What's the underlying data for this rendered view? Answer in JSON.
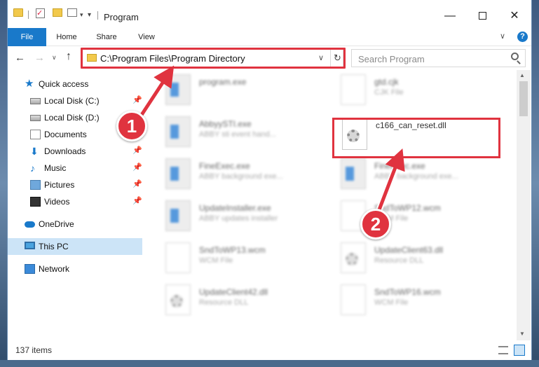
{
  "window": {
    "title": "Program"
  },
  "titlebar": {
    "qa_check_glyph": "✓",
    "caret": "▾",
    "down": "▾",
    "min": "—",
    "close": "✕"
  },
  "ribbon": {
    "tabs": [
      {
        "label": "File"
      },
      {
        "label": "Home"
      },
      {
        "label": "Share"
      },
      {
        "label": "View"
      }
    ],
    "chevron": "∨",
    "help": "?"
  },
  "nav": {
    "back": "←",
    "forward": "→",
    "recent": "∨",
    "up": "↑",
    "address": "C:\\Program Files\\Program Directory",
    "address_chevron": "∨",
    "refresh": "↻",
    "search_placeholder": "Search Program"
  },
  "sidebar": {
    "items": [
      {
        "label": "Quick access",
        "icon": "star-icon"
      },
      {
        "label": "Local Disk (C:)",
        "icon": "drive-icon"
      },
      {
        "label": "Local Disk (D:)",
        "icon": "drive-icon"
      },
      {
        "label": "Documents",
        "icon": "documents-icon"
      },
      {
        "label": "Downloads",
        "icon": "downloads-icon"
      },
      {
        "label": "Music",
        "icon": "music-icon"
      },
      {
        "label": "Pictures",
        "icon": "pictures-icon"
      },
      {
        "label": "Videos",
        "icon": "videos-icon"
      },
      {
        "label": "OneDrive",
        "icon": "cloud-icon"
      },
      {
        "label": "This PC",
        "icon": "computer-icon"
      },
      {
        "label": "Network",
        "icon": "network-icon"
      }
    ],
    "pin": "📌"
  },
  "files": [
    {
      "name": "program.exe",
      "desc": ""
    },
    {
      "name": "gtd.cjk",
      "desc": "CJK File"
    },
    {
      "name": "AbbyySTI.exe",
      "desc": "ABBY sti event hand..."
    },
    {
      "name": "c166_can_reset.dll",
      "desc": ""
    },
    {
      "name": "FineExec.exe",
      "desc": "ABBY background exe..."
    },
    {
      "name": "FineExec.exe",
      "desc": "ABBY background exe..."
    },
    {
      "name": "UpdateInstaller.exe",
      "desc": "ABBY updates installer"
    },
    {
      "name": "SndToWP12.wcm",
      "desc": "WCM File"
    },
    {
      "name": "SndToWP13.wcm",
      "desc": "WCM File"
    },
    {
      "name": "UpdateClient63.dll",
      "desc": "Resource DLL"
    },
    {
      "name": "UpdateClient42.dll",
      "desc": "Resource DLL"
    },
    {
      "name": "SndToWP16.wcm",
      "desc": "WCM File"
    }
  ],
  "scroll": {
    "up": "▲",
    "down": "▼"
  },
  "status": {
    "count": "137 items"
  },
  "annotations": {
    "badge1": "1",
    "badge2": "2"
  },
  "colors": {
    "accent": "#1979ca",
    "highlight": "#e0333f",
    "selected": "#cce4f7"
  }
}
